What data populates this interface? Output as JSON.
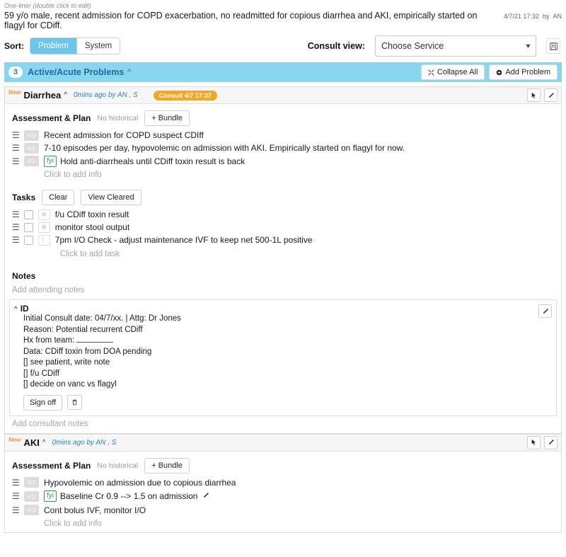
{
  "oneliner": {
    "label_main": "One-liner ",
    "label_hint": "(double click to edit)",
    "text": "59 y/o male, recent admission for COPD exacerbation, no readmitted for copious diarrhea and AKI, empirically started on flagyl for CDiff.",
    "timestamp": "4/7/21 17:32",
    "by_label": "by",
    "author": "AN"
  },
  "toolbar": {
    "sort_label": "Sort:",
    "sort_options": [
      "Problem",
      "System"
    ],
    "sort_active": "Problem",
    "consult_label": "Consult view:",
    "consult_value": "Choose Service",
    "save_icon": "floppy-disk-icon"
  },
  "section": {
    "count": "3",
    "title": "Active/Acute Problems",
    "collapse_label": "Collapse All",
    "add_label": "Add Problem"
  },
  "problems": [
    {
      "new_badge": "New",
      "name": "Diarrhea",
      "meta": "0mins ago by AN , S",
      "consult_pill": "Consult 4/7 17:37",
      "assessment": {
        "title": "Assessment & Plan",
        "historical": "No historical",
        "bundle_label": "+ Bundle",
        "items": [
          {
            "badge": "a/p",
            "fyi": "",
            "text": "Recent admission for COPD suspect CDIff"
          },
          {
            "badge": "a/p",
            "fyi": "",
            "text": "7-10 episodes per day, hypovolemic on admission with AKI. Empirically started on flagyl for now."
          },
          {
            "badge": "a/p",
            "fyi": "fyi",
            "text": "Hold anti-diarrheals until CDiff toxin result is back"
          }
        ],
        "add_hint": "Click to add info"
      },
      "tasks": {
        "title": "Tasks",
        "clear_label": "Clear",
        "view_cleared_label": "View Cleared",
        "items": [
          {
            "icon": "sun-icon",
            "glyph": "✻",
            "text": "f/u CDiff toxin result"
          },
          {
            "icon": "sun-icon",
            "glyph": "✻",
            "text": "monitor stool output"
          },
          {
            "icon": "moon-icon",
            "glyph": "☾",
            "text": "7pm I/O Check - adjust maintenance IVF to keep net 500-1L positive"
          }
        ],
        "add_hint": "Click to add task"
      },
      "notes": {
        "title": "Notes",
        "attending_hint": "Add attending notes",
        "note_title": "ID",
        "lines": [
          "Initial Consult date: 04/7/xx. | Attg: Dr Jones",
          "Reason: Potential recurrent CDiff",
          "Hx from team:",
          "Data: CDiff toxin from DOA pending",
          "[] see patient, write note",
          "[] f/u CDiff",
          "[] decide on vanc vs flagyl"
        ],
        "signoff_label": "Sign off",
        "consultant_hint": "Add consultant notes"
      }
    },
    {
      "new_badge": "New",
      "name": "AKI",
      "meta": "0mins ago by AN , S",
      "consult_pill": "",
      "assessment": {
        "title": "Assessment & Plan",
        "historical": "No historical",
        "bundle_label": "+ Bundle",
        "items": [
          {
            "badge": "a/p",
            "fyi": "",
            "text": "Hypovolemic on admission due to copious diarrhea"
          },
          {
            "badge": "a/p",
            "fyi": "fyi",
            "text": "Baseline Cr 0.9 --> 1.5 on admission"
          },
          {
            "badge": "a/p",
            "fyi": "",
            "text": "Cont bolus IVF, monitor I/O"
          }
        ],
        "add_hint": "Click to add info"
      }
    }
  ],
  "colors": {
    "section_blue": "#8ad5f0",
    "accent_blue": "#6cc5ea",
    "orange": "#f5a623",
    "fyi_green": "#3a9a49"
  }
}
